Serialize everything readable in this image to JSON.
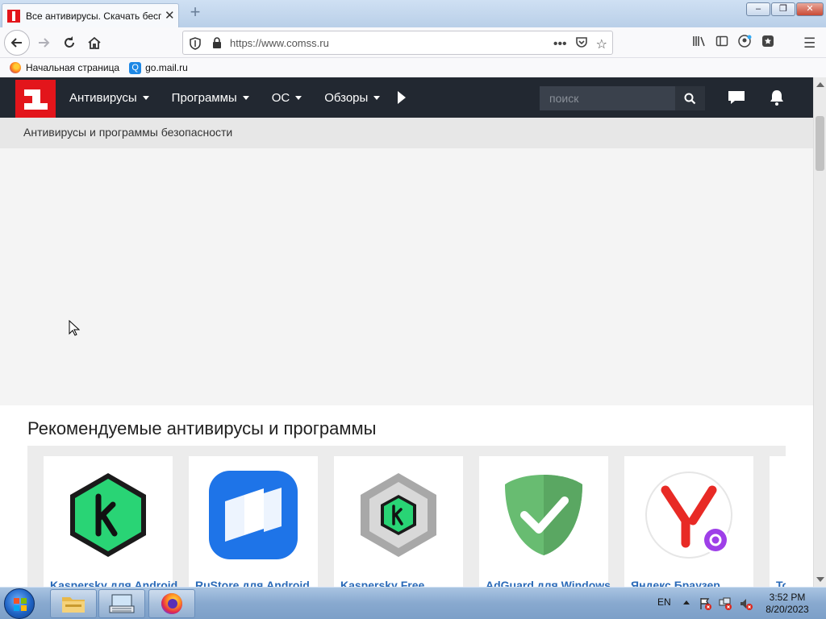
{
  "browser": {
    "tab_title": "Все антивирусы. Скачать бесплатно",
    "new_tab": "+",
    "url": "https://www.comss.ru",
    "window_controls": {
      "minimize": "–",
      "maximize": "❐",
      "close": "✕"
    }
  },
  "bookmarks": [
    {
      "label": "Начальная страница",
      "icon": "firefox-icon"
    },
    {
      "label": "go.mail.ru",
      "icon": "search-icon"
    }
  ],
  "site": {
    "nav": [
      {
        "label": "Антивирусы"
      },
      {
        "label": "Программы"
      },
      {
        "label": "ОС"
      },
      {
        "label": "Обзоры"
      }
    ],
    "search_placeholder": "поиск",
    "breadcrumb": "Антивирусы и программы безопасности",
    "recommended_title": "Рекомендуемые антивирусы и программы",
    "cards": [
      {
        "title": "Kaspersky для Android",
        "icon": "kaspersky-icon",
        "color": "#1ccd6e"
      },
      {
        "title": "RuStore для Android",
        "icon": "rustore-icon",
        "color": "#1e74e8"
      },
      {
        "title": "Kaspersky Free",
        "icon": "kaspersky-free-icon",
        "color": "#9a9a9a"
      },
      {
        "title": "AdGuard для Windows",
        "icon": "adguard-icon",
        "color": "#68bc71"
      },
      {
        "title": "Яндекс Браузер",
        "icon": "yandex-browser-icon",
        "color": "#e82a25"
      },
      {
        "title": "Tor Browser",
        "icon": "tor-icon",
        "color": "#7d4698"
      }
    ]
  },
  "taskbar": {
    "language": "EN",
    "time": "3:52 PM",
    "date": "8/20/2023"
  }
}
